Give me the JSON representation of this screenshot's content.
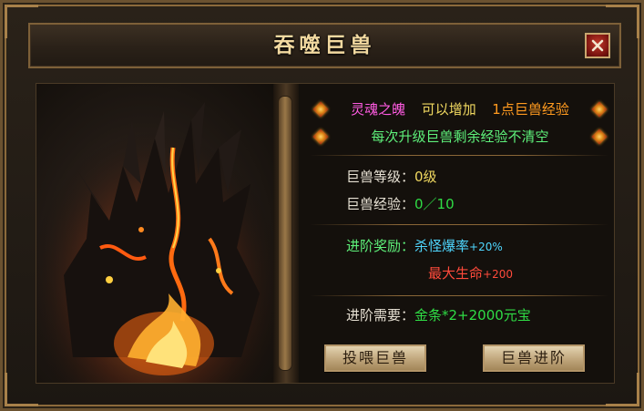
{
  "window": {
    "title": "吞噬巨兽"
  },
  "notice": {
    "line1_a": "灵魂之魄",
    "line1_b": "可以增加",
    "line1_c": "1点巨兽经验",
    "line2": "每次升级巨兽剩余经验不清空"
  },
  "stats": {
    "level_label": "巨兽等级：",
    "level_value": "0级",
    "exp_label": "巨兽经验：",
    "exp_value": "0／10"
  },
  "reward": {
    "label": "进阶奖励：",
    "items": [
      {
        "name": "杀怪爆率",
        "bonus": "+20%"
      },
      {
        "name": "最大生命",
        "bonus": "+200"
      }
    ]
  },
  "requirement": {
    "label": "进阶需要：",
    "value": "金条*2+2000元宝"
  },
  "buttons": {
    "feed": "投喂巨兽",
    "advance": "巨兽进阶"
  },
  "icons": {
    "close": "close-icon",
    "bullet": "diamond-bullet-icon"
  },
  "colors": {
    "frame_gold": "#8c6a3b",
    "title_text": "#f2d9a0",
    "highlight_pink": "#ff5be2",
    "highlight_orange": "#ff9a1f",
    "value_green": "#2fdc45",
    "bonus_cyan": "#4fd7ff",
    "bonus_red": "#ff4a3b"
  }
}
